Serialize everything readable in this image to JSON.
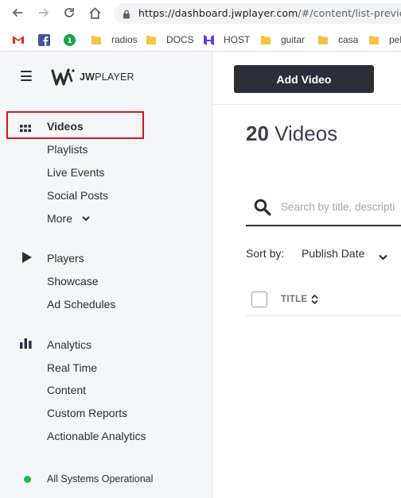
{
  "browser": {
    "url_host": "https://dashboard.jwplayer.com",
    "url_rest": "/#/content/list-previe",
    "bookmarks": [
      {
        "label": "",
        "icon": "gmail-icon"
      },
      {
        "label": "",
        "icon": "facebook-icon"
      },
      {
        "label": "",
        "icon": "green-badge-icon",
        "badge": "1"
      },
      {
        "label": "radios",
        "icon": "folder-icon"
      },
      {
        "label": "DOCS",
        "icon": "folder-icon"
      },
      {
        "label": "HOST",
        "icon": "hostinger-icon"
      },
      {
        "label": "guitar",
        "icon": "folder-icon"
      },
      {
        "label": "casa",
        "icon": "folder-icon"
      },
      {
        "label": "peli",
        "icon": "folder-icon"
      }
    ]
  },
  "logo": {
    "bold": "JW",
    "thin": "PLAYER"
  },
  "sidebar": {
    "videos": "Videos",
    "playlists": "Playlists",
    "live_events": "Live Events",
    "social_posts": "Social Posts",
    "more": "More",
    "players": "Players",
    "showcase": "Showcase",
    "ad_schedules": "Ad Schedules",
    "analytics": "Analytics",
    "real_time": "Real Time",
    "content": "Content",
    "custom_reports": "Custom Reports",
    "actionable_analytics": "Actionable Analytics",
    "status": "All Systems Operational"
  },
  "main": {
    "add_video": "Add Video",
    "count": "20",
    "title_word": "Videos",
    "search_placeholder": "Search by title, descripti",
    "sort_label": "Sort by:",
    "sort_value": "Publish Date",
    "col_title": "TITLE"
  },
  "colors": {
    "accent": "#2b2d3b",
    "highlight": "#e0121b",
    "status_ok": "#1db954"
  }
}
